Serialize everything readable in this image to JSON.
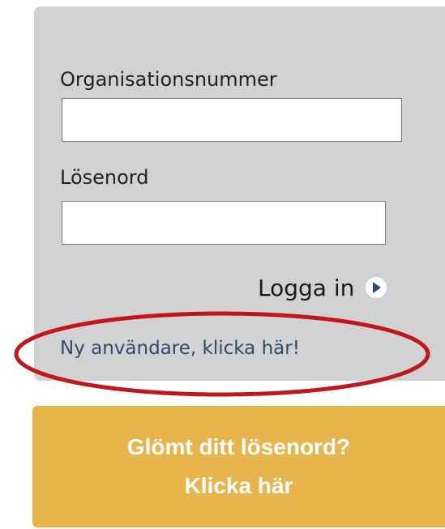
{
  "login": {
    "org_label": "Organisationsnummer",
    "org_value": "",
    "password_label": "Lösenord",
    "password_value": "",
    "login_label": "Logga in",
    "login_icon": "circle-arrow-right-icon",
    "new_user_label": "Ny användare, klicka här!"
  },
  "forgot": {
    "line1": "Glömt ditt lösenord?",
    "line2": "Klicka här"
  },
  "annotation": {
    "highlight_color": "#c0161c",
    "shape": "ellipse"
  },
  "colors": {
    "panel": "#d2d2d2",
    "forgot_button": "#e8b54c",
    "link": "#2f4a6b",
    "icon": "#2a4d8a"
  }
}
